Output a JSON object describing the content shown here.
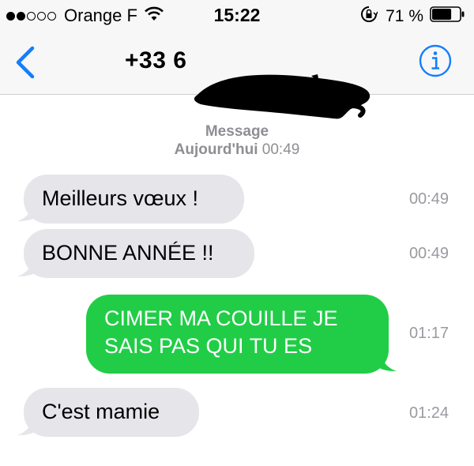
{
  "status_bar": {
    "carrier": "Orange F",
    "time": "15:22",
    "battery_percent": "71 %",
    "signal_bars_filled": 2,
    "signal_bars_total": 5,
    "battery_level": 0.71
  },
  "nav": {
    "contact": "+33 6",
    "info_icon": "info-icon",
    "back_icon": "chevron-left-icon",
    "accent_color": "#147efb"
  },
  "thread": {
    "header_label": "Message",
    "header_day": "Aujourd'hui",
    "header_time": "00:49"
  },
  "messages": [
    {
      "direction": "incoming",
      "text": "Meilleurs vœux !",
      "time": "00:49"
    },
    {
      "direction": "incoming",
      "text": "BONNE ANNÉE !!",
      "time": "00:49"
    },
    {
      "direction": "outgoing",
      "text_line1": "CIMER MA COUILLE JE",
      "text_line2": "SAIS PAS QUI TU ES",
      "time": "01:17"
    },
    {
      "direction": "incoming",
      "text": "C'est mamie",
      "time": "01:24"
    }
  ],
  "colors": {
    "incoming_bubble": "#e5e5ea",
    "outgoing_bubble": "#21cd47",
    "timestamp": "#9a9aa0"
  }
}
